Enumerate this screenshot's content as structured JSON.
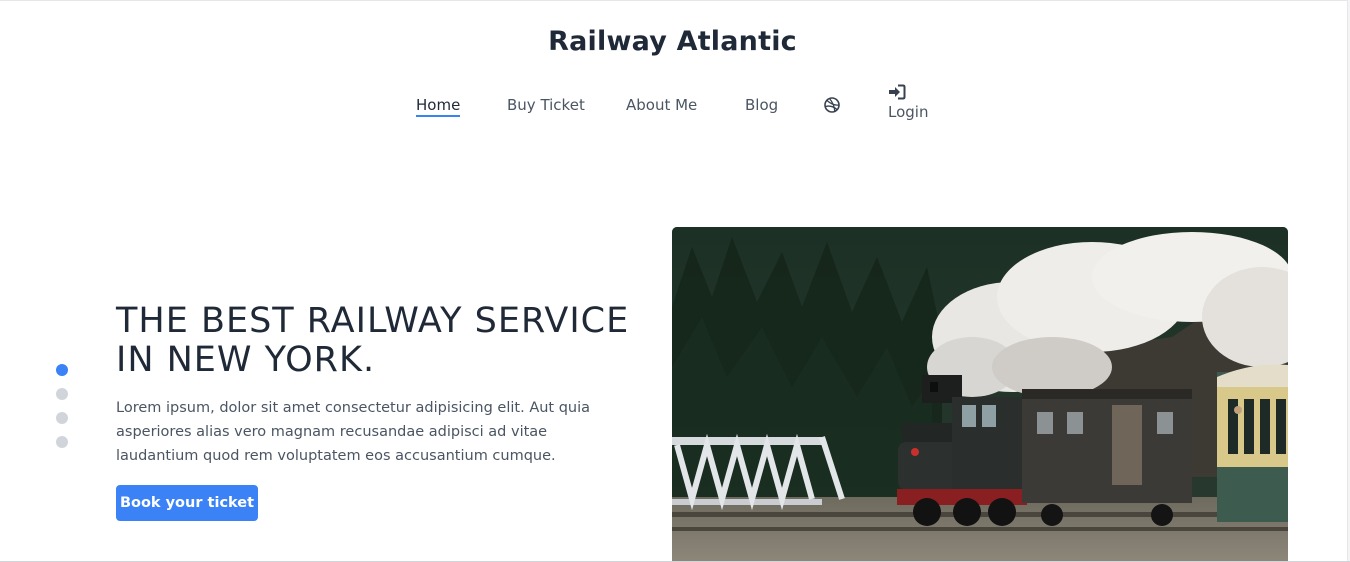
{
  "site": {
    "title": "Railway Atlantic"
  },
  "nav": {
    "items": [
      {
        "label": "Home",
        "active": true
      },
      {
        "label": "Buy Ticket"
      },
      {
        "label": "About Me"
      },
      {
        "label": "Blog"
      }
    ],
    "dribbble_icon": "dribbble-icon",
    "login": {
      "icon": "sign-in-icon",
      "label": "Login"
    }
  },
  "hero": {
    "heading_line1": "THE BEST RAILWAY SERVICE",
    "heading_line2": "IN NEW YORK.",
    "text": "Lorem ipsum, dolor sit amet consectetur adipisicing elit. Aut quia asperiores alias vero magnam recusandae adipisci ad vitae laudantium quod rem voluptatem eos accusantium cumque.",
    "cta_label": "Book your ticket",
    "image": "steam-train-photo"
  },
  "slider": {
    "count": 4,
    "active_index": 0
  },
  "colors": {
    "accent": "#3b82f6",
    "text": "#1f2937",
    "muted": "#4b5563",
    "dot_inactive": "#d1d5db"
  }
}
